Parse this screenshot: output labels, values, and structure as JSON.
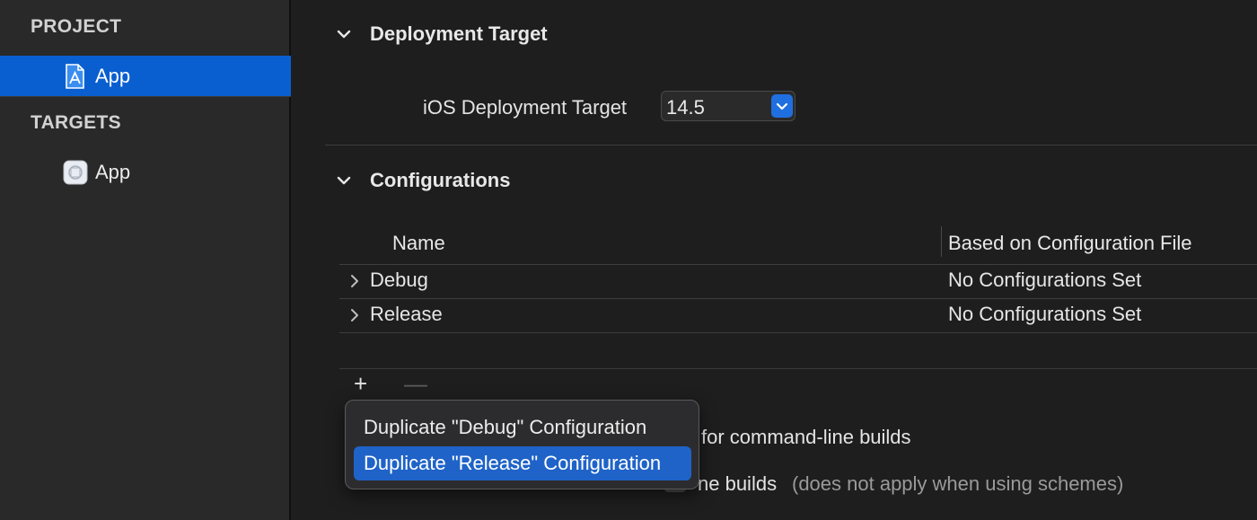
{
  "sidebar": {
    "project_header": "PROJECT",
    "project_item": "App",
    "targets_header": "TARGETS",
    "target_item": "App"
  },
  "deployment": {
    "title": "Deployment Target",
    "field_label": "iOS Deployment Target",
    "value": "14.5"
  },
  "configurations": {
    "title": "Configurations",
    "columns": [
      "Name",
      "Based on Configuration File"
    ],
    "rows": [
      {
        "name": "Debug",
        "file": "No Configurations Set"
      },
      {
        "name": "Release",
        "file": "No Configurations Set"
      }
    ],
    "add_label": "+",
    "remove_label": "—"
  },
  "background_text": {
    "line1": "for command-line builds",
    "line2": "ne builds",
    "line2_note": "(does not apply when using schemes)"
  },
  "menu": {
    "items": [
      "Duplicate \"Debug\" Configuration",
      "Duplicate \"Release\" Configuration"
    ],
    "highlighted_index": 1
  },
  "colors": {
    "accent": "#0a5fd0",
    "menu_highlight": "#1f63c8",
    "background": "#1e1e1e",
    "sidebar": "#292929"
  }
}
